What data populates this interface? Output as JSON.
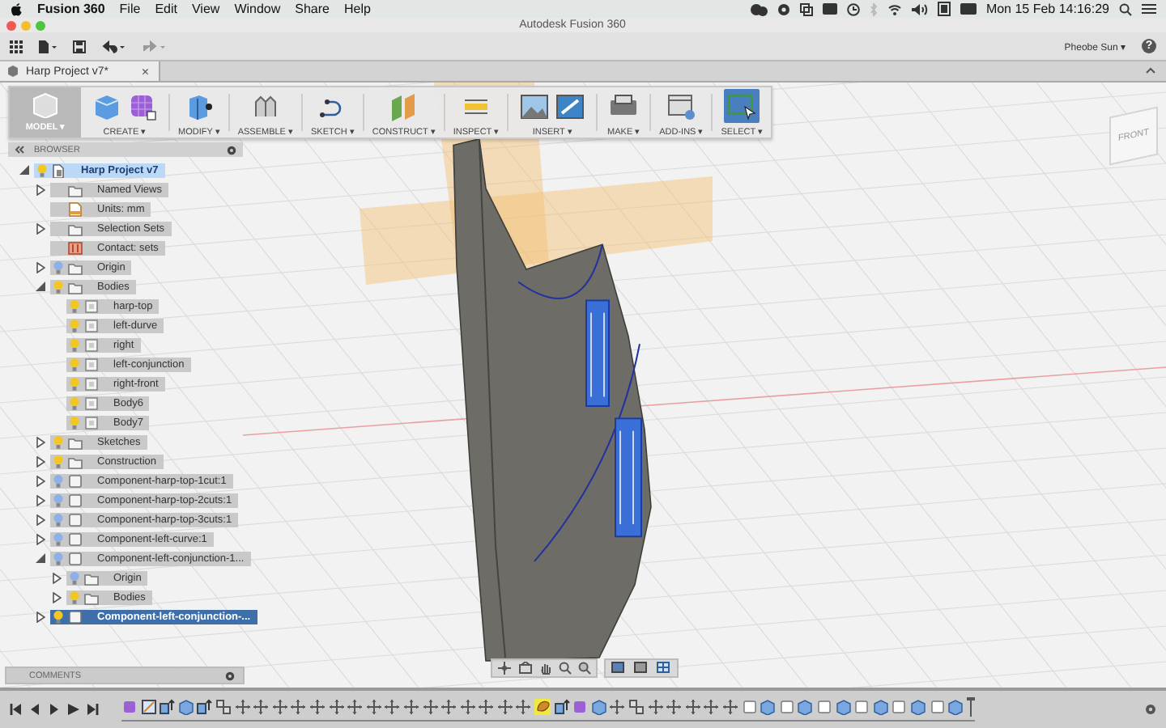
{
  "menubar": {
    "app": "Fusion 360",
    "menus": [
      "File",
      "Edit",
      "View",
      "Window",
      "Share",
      "Help"
    ],
    "clock": "Mon 15 Feb 14:16:29"
  },
  "window": {
    "title": "Autodesk Fusion 360"
  },
  "toolbar": {
    "user": "Pheobe Sun ▾",
    "help": "?"
  },
  "tabs": [
    {
      "label": "Harp Project v7*",
      "close": "×",
      "selected": true
    }
  ],
  "ribbon": {
    "workspace": "MODEL ▾",
    "groups": [
      {
        "label": "CREATE ▾",
        "kind": "create",
        "active": false
      },
      {
        "label": "MODIFY ▾",
        "kind": "modify",
        "active": false
      },
      {
        "label": "ASSEMBLE ▾",
        "kind": "assemble",
        "active": false
      },
      {
        "label": "SKETCH ▾",
        "kind": "sketch",
        "active": false
      },
      {
        "label": "CONSTRUCT ▾",
        "kind": "construct",
        "active": false
      },
      {
        "label": "INSPECT ▾",
        "kind": "inspect",
        "active": false
      },
      {
        "label": "INSERT ▾",
        "kind": "insert",
        "active": false
      },
      {
        "label": "MAKE ▾",
        "kind": "make",
        "active": false
      },
      {
        "label": "ADD-INS ▾",
        "kind": "addins",
        "active": false
      },
      {
        "label": "SELECT ▾",
        "kind": "select",
        "active": true
      }
    ]
  },
  "browser": {
    "title": "BROWSER",
    "tree": [
      {
        "label": "Harp Project v7",
        "kind": "root",
        "visible": true,
        "expanded": true,
        "selected": false,
        "children": [
          {
            "label": "Named Views",
            "kind": "folder",
            "expanded": false,
            "selected": false
          },
          {
            "label": "Units: mm",
            "kind": "units",
            "selected": false
          },
          {
            "label": "Selection Sets",
            "kind": "folder",
            "expanded": false,
            "selected": false
          },
          {
            "label": "Contact: sets",
            "kind": "contact",
            "selected": false
          },
          {
            "label": "Origin",
            "kind": "folder",
            "visible": false,
            "expanded": false,
            "selected": false
          },
          {
            "label": "Bodies",
            "kind": "folder",
            "visible": true,
            "expanded": true,
            "selected": false,
            "children": [
              {
                "label": "harp-top",
                "kind": "body",
                "visible": true,
                "selected": false
              },
              {
                "label": "left-durve",
                "kind": "body",
                "visible": true,
                "selected": false
              },
              {
                "label": "right",
                "kind": "body",
                "visible": true,
                "selected": false
              },
              {
                "label": "left-conjunction",
                "kind": "body",
                "visible": true,
                "selected": false
              },
              {
                "label": "right-front",
                "kind": "body",
                "visible": true,
                "selected": false
              },
              {
                "label": "Body6",
                "kind": "body",
                "visible": true,
                "selected": false
              },
              {
                "label": "Body7",
                "kind": "body",
                "visible": true,
                "selected": false
              }
            ]
          },
          {
            "label": "Sketches",
            "kind": "folder",
            "visible": true,
            "expanded": false,
            "selected": false
          },
          {
            "label": "Construction",
            "kind": "folder",
            "visible": true,
            "expanded": false,
            "selected": false
          },
          {
            "label": "Component-harp-top-1cut:1",
            "kind": "component",
            "visible": false,
            "expanded": false,
            "selected": false
          },
          {
            "label": "Component-harp-top-2cuts:1",
            "kind": "component",
            "visible": false,
            "expanded": false,
            "selected": false
          },
          {
            "label": "Component-harp-top-3cuts:1",
            "kind": "component",
            "visible": false,
            "expanded": false,
            "selected": false
          },
          {
            "label": "Component-left-curve:1",
            "kind": "component",
            "visible": false,
            "expanded": false,
            "selected": false
          },
          {
            "label": "Component-left-conjunction-1...",
            "kind": "component",
            "visible": false,
            "expanded": true,
            "selected": false,
            "children": [
              {
                "label": "Origin",
                "kind": "folder",
                "visible": false,
                "expanded": false,
                "selected": false
              },
              {
                "label": "Bodies",
                "kind": "folder",
                "visible": true,
                "expanded": false,
                "selected": false
              }
            ]
          },
          {
            "label": "Component-left-conjunction-...",
            "kind": "component",
            "visible": true,
            "expanded": false,
            "selected": true
          }
        ]
      }
    ]
  },
  "viewcube": {
    "label": "FRONT"
  },
  "comments": {
    "title": "COMMENTS"
  },
  "timeline": {
    "features": [
      {
        "kind": "body",
        "selected": false
      },
      {
        "kind": "sketch",
        "selected": false
      },
      {
        "kind": "extrude",
        "selected": false
      },
      {
        "kind": "box",
        "selected": false
      },
      {
        "kind": "extrude",
        "selected": false
      },
      {
        "kind": "joint",
        "selected": false
      },
      {
        "kind": "move",
        "selected": false
      },
      {
        "kind": "move",
        "selected": false
      },
      {
        "kind": "move",
        "selected": false
      },
      {
        "kind": "move",
        "selected": false
      },
      {
        "kind": "move",
        "selected": false
      },
      {
        "kind": "move",
        "selected": false
      },
      {
        "kind": "move",
        "selected": false
      },
      {
        "kind": "move",
        "selected": false
      },
      {
        "kind": "move",
        "selected": false
      },
      {
        "kind": "move",
        "selected": false
      },
      {
        "kind": "move",
        "selected": false
      },
      {
        "kind": "move",
        "selected": false
      },
      {
        "kind": "move",
        "selected": false
      },
      {
        "kind": "move",
        "selected": false
      },
      {
        "kind": "move",
        "selected": false
      },
      {
        "kind": "move",
        "selected": false
      },
      {
        "kind": "form",
        "selected": true
      },
      {
        "kind": "extrude",
        "selected": false
      },
      {
        "kind": "body",
        "selected": false
      },
      {
        "kind": "box",
        "selected": false
      },
      {
        "kind": "move",
        "selected": false
      },
      {
        "kind": "joint",
        "selected": false
      },
      {
        "kind": "move",
        "selected": false
      },
      {
        "kind": "move",
        "selected": false
      },
      {
        "kind": "move",
        "selected": false
      },
      {
        "kind": "move",
        "selected": false
      },
      {
        "kind": "move",
        "selected": false
      },
      {
        "kind": "plain",
        "selected": false
      },
      {
        "kind": "box",
        "selected": false
      },
      {
        "kind": "plain",
        "selected": false
      },
      {
        "kind": "box",
        "selected": false
      },
      {
        "kind": "plain",
        "selected": false
      },
      {
        "kind": "box",
        "selected": false
      },
      {
        "kind": "plain",
        "selected": false
      },
      {
        "kind": "box",
        "selected": false
      },
      {
        "kind": "plain",
        "selected": false
      },
      {
        "kind": "box",
        "selected": false
      },
      {
        "kind": "plain",
        "selected": false
      },
      {
        "kind": "box",
        "selected": false
      }
    ]
  }
}
